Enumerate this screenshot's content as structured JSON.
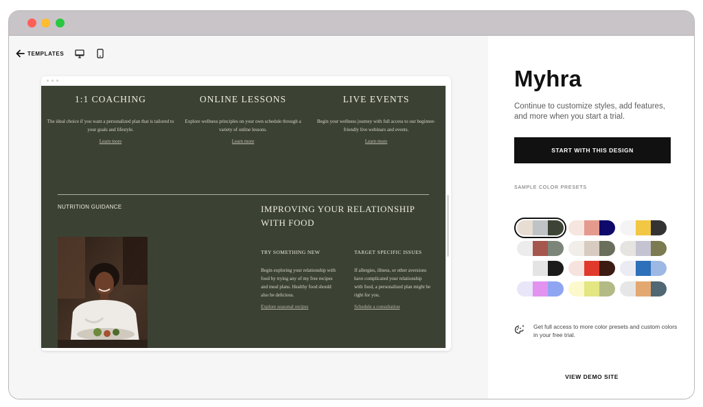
{
  "toolbar": {
    "back_label": "TEMPLATES",
    "icons": [
      "arrow-left-icon",
      "desktop-icon",
      "mobile-icon"
    ]
  },
  "preview": {
    "columns": [
      {
        "title": "1:1 COACHING",
        "desc": "The ideal choice if you want a personalized plan that is tailored to your goals and lifestyle.",
        "link": "Learn more"
      },
      {
        "title": "ONLINE LESSONS",
        "desc": "Explore wellness principles on your own schedule through a variety of online lessons.",
        "link": "Learn more"
      },
      {
        "title": "LIVE EVENTS",
        "desc": "Begin your wellness journey with full access to our beginner-friendly live webinars and events.",
        "link": "Learn more"
      }
    ],
    "nutrition_label": "NUTRITION GUIDANCE",
    "heading": "IMPROVING YOUR RELATIONSHIP WITH FOOD",
    "sub_left": {
      "title": "TRY SOMETHING NEW",
      "desc": "Begin exploring your relationship with food by trying any of my free recipes and meal plans. Healthy food should also be delicious.",
      "link": "Explore seasonal recipes"
    },
    "sub_right": {
      "title": "TARGET SPECIFIC ISSUES",
      "desc": "If allergies, illness, or other aversions have complicated your relationship with food, a personalized plan might be right for you.",
      "link": "Schedule a consultation"
    },
    "background_color": "#3b4234"
  },
  "panel": {
    "title": "Myhra",
    "subtitle": "Continue to customize styles, add features, and more when you start a trial.",
    "start_button": "START WITH THIS DESIGN",
    "presets_label": "SAMPLE COLOR PRESETS",
    "presets": [
      [
        "#e7ddd3",
        "#bfc3c6",
        "#3d4435"
      ],
      [
        "#f6e6e0",
        "#e59a8e",
        "#0e0a6b"
      ],
      [
        "#f4f4f4",
        "#f2c744",
        "#333333"
      ],
      [
        "#ececec",
        "#a5574e",
        "#7c8579"
      ],
      [
        "#f1ede8",
        "#d8cbc0",
        "#6a6f5c"
      ],
      [
        "#e6e4e0",
        "#c4c3d2",
        "#7b7a50"
      ],
      [
        "#ffffff",
        "#e4e4e4",
        "#1b1b1b"
      ],
      [
        "#f6e3de",
        "#e03a2c",
        "#3c1b12"
      ],
      [
        "#ebebf3",
        "#2e70b9",
        "#9db8e2"
      ],
      [
        "#e8e6f8",
        "#e293f0",
        "#8fa5f2"
      ],
      [
        "#fcf9cd",
        "#e3e681",
        "#b4ba86"
      ],
      [
        "#e6e6e6",
        "#e2a870",
        "#4f6873"
      ]
    ],
    "selected_preset": 0,
    "promo_text": "Get full access to more color presets and custom colors in your free trial.",
    "demo_link": "VIEW DEMO SITE"
  }
}
